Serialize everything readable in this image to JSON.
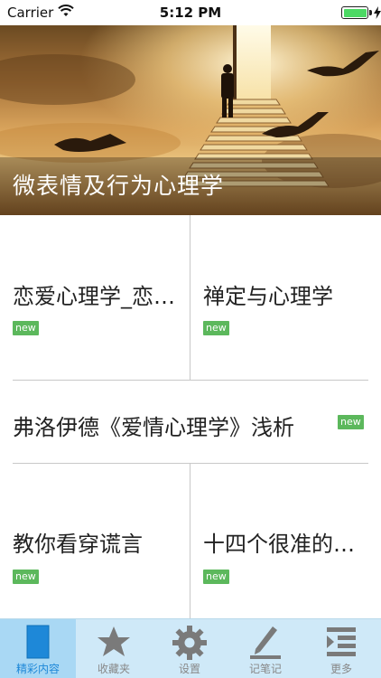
{
  "status_bar": {
    "carrier": "Carrier",
    "time": "5:12 PM",
    "battery_color": "#4cd964"
  },
  "hero": {
    "title": "微表情及行为心理学"
  },
  "grid": {
    "cells": [
      {
        "title": "恋爱心理学_恋爱心理学",
        "badge": "new"
      },
      {
        "title": "禅定与心理学",
        "badge": "new"
      },
      {
        "title": "弗洛伊德《爱情心理学》浅析",
        "badge": "new"
      },
      {
        "title": "教你看穿谎言",
        "badge": "new"
      },
      {
        "title": "十四个很准的心理测试",
        "badge": "new"
      }
    ],
    "badge_color": "#5cb85c"
  },
  "tabbar": {
    "active_color": "#1e88d8",
    "tabs": [
      {
        "label": "精彩内容",
        "icon": "document-icon",
        "active": true
      },
      {
        "label": "收藏夹",
        "icon": "star-icon",
        "active": false
      },
      {
        "label": "设置",
        "icon": "gear-icon",
        "active": false
      },
      {
        "label": "记笔记",
        "icon": "pen-icon",
        "active": false
      },
      {
        "label": "更多",
        "icon": "more-list-icon",
        "active": false
      }
    ]
  }
}
